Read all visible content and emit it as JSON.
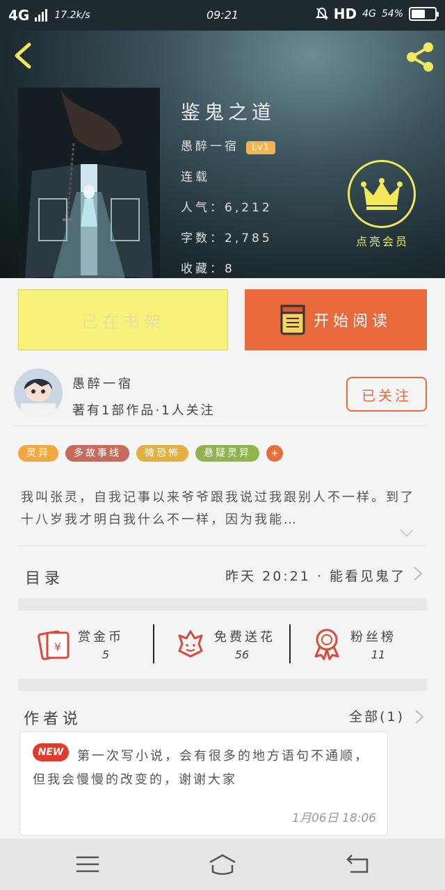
{
  "status_bar": {
    "network": "4G",
    "speed": "17.2k/s",
    "time": "09:21",
    "hd": "HD",
    "net2": "4G",
    "battery": "54%"
  },
  "header": {
    "title": "鉴鬼之道",
    "author": "愚醉一宿",
    "level": "Lv1",
    "status": "连载",
    "popularity": "人气：6,212",
    "word_count": "字数：2,785",
    "favorites": "收藏：8",
    "vip_label": "点亮会员"
  },
  "actions": {
    "shelf": "已在书架",
    "read": "开始阅读"
  },
  "author_row": {
    "name": "愚醉一宿",
    "stats": "著有1部作品·1人关注",
    "follow": "已关注"
  },
  "tags": [
    {
      "label": "灵异",
      "color": "#f0a940"
    },
    {
      "label": "多故事线",
      "color": "#c96b5c"
    },
    {
      "label": "微恐怖",
      "color": "#e3b03f"
    },
    {
      "label": "悬疑灵异",
      "color": "#8fb44f"
    }
  ],
  "tag_more": "+",
  "synopsis": "我叫张灵，自我记事以来爷爷跟我说过我跟别人不一样。到了十八岁我才明白我什么不一样，因为我能…",
  "toc": {
    "label": "目录",
    "latest": "昨天 20:21 · 能看见鬼了"
  },
  "stats": [
    {
      "name": "赏金币",
      "value": "5"
    },
    {
      "name": "免费送花",
      "value": "56"
    },
    {
      "name": "粉丝榜",
      "value": "11"
    }
  ],
  "author_said": {
    "title": "作者说",
    "all": "全部(1)",
    "badge": "NEW",
    "text": "第一次写小说，会有很多的地方语句不通顺，但我会慢慢的改变的，谢谢大家",
    "time": "1月06日  18:06"
  },
  "colors": {
    "accent": "#e86a3c",
    "shelf_bg": "#f9f27a",
    "crown": "#f3e85c"
  }
}
